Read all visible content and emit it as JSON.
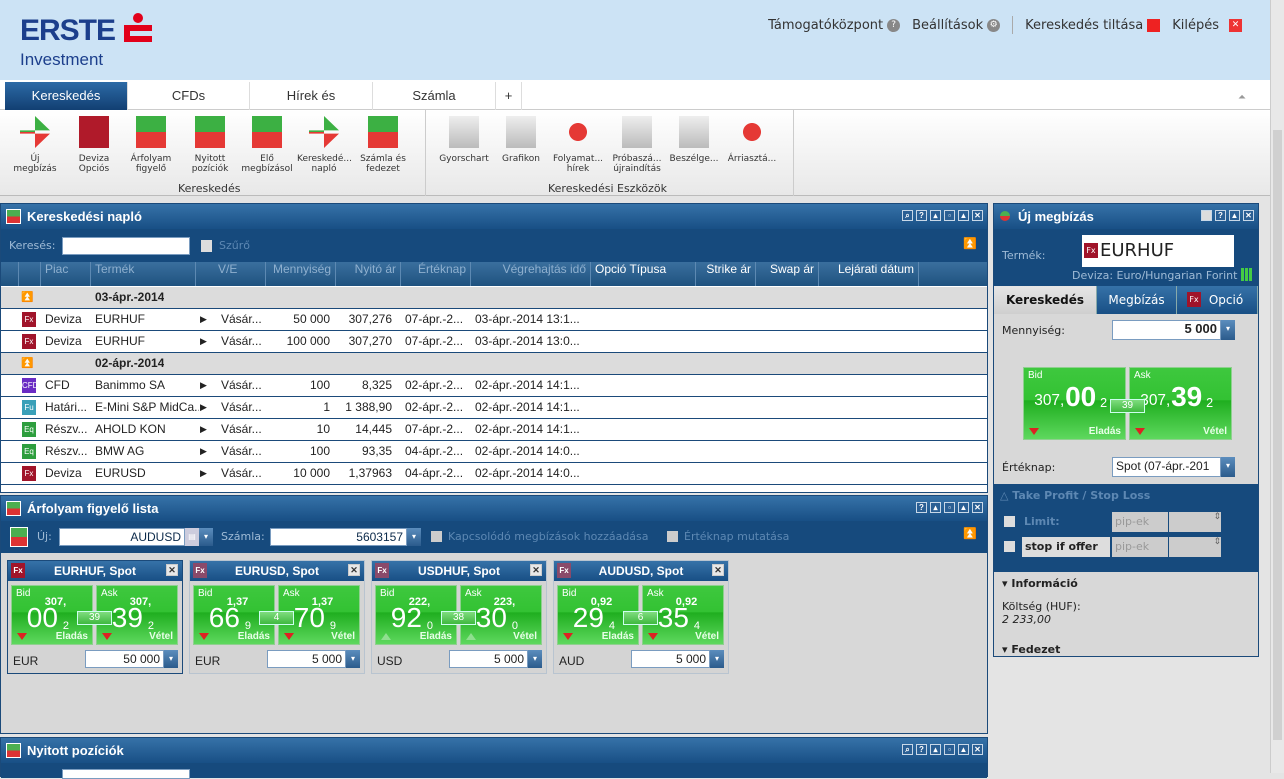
{
  "brand": {
    "line1": "ERSTE",
    "line2": "Investment",
    "color": "#1c3f8c",
    "accent": "#e2001a"
  },
  "toplinks": [
    {
      "label": "Támogatóközpont",
      "icon": "help-icon"
    },
    {
      "label": "Beállítások",
      "icon": "gear-icon"
    },
    {
      "label": "Kereskedés tiltása",
      "icon": "stop-icon"
    },
    {
      "label": "Kilépés",
      "icon": "close-icon"
    }
  ],
  "tabs": [
    "Kereskedés",
    "CFDs",
    "Hírek és",
    "Számla",
    "+"
  ],
  "ribbon": {
    "groups": [
      "Kereskedés",
      "Kereskedési Eszközök"
    ],
    "items": [
      [
        "Új",
        "megbízás"
      ],
      [
        "Deviza",
        "Opciós"
      ],
      [
        "Árfolyam",
        "figyelő"
      ],
      [
        "Nyitott",
        "pozíciók"
      ],
      [
        "Elő",
        "megbízásol"
      ],
      [
        "Kereskedé...",
        "napló"
      ],
      [
        "Számla és",
        "fedezet"
      ],
      [
        "Gyorschart",
        ""
      ],
      [
        "Grafikon",
        ""
      ],
      [
        "Folyamat...",
        "hírek"
      ],
      [
        "Próbaszá...",
        "újraindítás"
      ],
      [
        "Beszélge...",
        ""
      ],
      [
        "Árriasztá...",
        ""
      ]
    ]
  },
  "journal": {
    "title": "Kereskedési napló",
    "search_label": "Keresés:",
    "search_value": "",
    "filter_label": "Szűrő",
    "columns": [
      "Piac",
      "Termék",
      "V/E",
      "Mennyiség",
      "Nyitó ár",
      "Értéknap",
      "Végrehajtás idő",
      "Opció Típusa",
      "Strike ár",
      "Swap ár",
      "Lejárati dátum"
    ],
    "groups": [
      {
        "date": "03-ápr.-2014",
        "rows": [
          {
            "type": "Fx",
            "market": "Deviza",
            "product": "EURHUF",
            "side": "Vásár...",
            "qty": "50 000",
            "price": "307,276",
            "value": "07-ápr.-2...",
            "exec": "03-ápr.-2014 13:1..."
          },
          {
            "type": "Fx",
            "market": "Deviza",
            "product": "EURHUF",
            "side": "Vásár...",
            "qty": "100 000",
            "price": "307,270",
            "value": "07-ápr.-2...",
            "exec": "03-ápr.-2014 13:0..."
          }
        ]
      },
      {
        "date": "02-ápr.-2014",
        "rows": [
          {
            "type": "CFD",
            "market": "CFD",
            "product": "Banimmo SA",
            "side": "Vásár...",
            "qty": "100",
            "price": "8,325",
            "value": "02-ápr.-2...",
            "exec": "02-ápr.-2014 14:1..."
          },
          {
            "type": "Fu",
            "market": "Határi...",
            "product": "E-Mini S&P MidCa...",
            "side": "Vásár...",
            "qty": "1",
            "price": "1 388,90",
            "value": "02-ápr.-2...",
            "exec": "02-ápr.-2014 14:1..."
          },
          {
            "type": "Eq",
            "market": "Részv...",
            "product": "AHOLD KON",
            "side": "Vásár...",
            "qty": "10",
            "price": "14,445",
            "value": "07-ápr.-2...",
            "exec": "02-ápr.-2014 14:1..."
          },
          {
            "type": "Eq",
            "market": "Részv...",
            "product": "BMW AG",
            "side": "Vásár...",
            "qty": "100",
            "price": "93,35",
            "value": "04-ápr.-2...",
            "exec": "02-ápr.-2014 14:0..."
          },
          {
            "type": "Fx",
            "market": "Deviza",
            "product": "EURUSD",
            "side": "Vásár...",
            "qty": "10 000",
            "price": "1,37963",
            "value": "04-ápr.-2...",
            "exec": "02-ápr.-2014 14:0..."
          }
        ]
      }
    ]
  },
  "watch": {
    "title": "Árfolyam figyelő lista",
    "new_label": "Új:",
    "new_value": "AUDUSD",
    "account_label": "Számla:",
    "account_value": "5603157",
    "opt1": "Kapcsolódó megbízások hozzáadása",
    "opt2": "Értéknap mutatása",
    "cards": [
      {
        "title": "EURHUF, Spot",
        "bid_pre": "307,",
        "bid_big": "00",
        "bid_sub": "2",
        "ask_pre": "307,",
        "ask_big": "39",
        "ask_sub": "2",
        "spread": "39",
        "dir": "down",
        "ccy": "EUR",
        "qty": "50 000"
      },
      {
        "title": "EURUSD, Spot",
        "bid_pre": "1,37",
        "bid_big": "66",
        "bid_sub": "9",
        "ask_pre": "1,37",
        "ask_big": "70",
        "ask_sub": "9",
        "spread": "4",
        "dir": "down",
        "ccy": "EUR",
        "qty": "5 000"
      },
      {
        "title": "USDHUF, Spot",
        "bid_pre": "222,",
        "bid_big": "92",
        "bid_sub": "0",
        "ask_pre": "223,",
        "ask_big": "30",
        "ask_sub": "0",
        "spread": "38",
        "dir": "up",
        "ccy": "USD",
        "qty": "5 000"
      },
      {
        "title": "AUDUSD, Spot",
        "bid_pre": "0,92",
        "bid_big": "29",
        "bid_sub": "4",
        "ask_pre": "0,92",
        "ask_big": "35",
        "ask_sub": "4",
        "spread": "6",
        "dir": "down",
        "ccy": "AUD",
        "qty": "5 000"
      }
    ],
    "bid": "Bid",
    "ask": "Ask",
    "sell": "Eladás",
    "buy": "Vétel"
  },
  "positions": {
    "title": "Nyitott pozíciók"
  },
  "order": {
    "title": "Új megbízás",
    "product_label": "Termék:",
    "product": "EURHUF",
    "desc": "Deviza: Euro/Hungarian Forint",
    "tabs": [
      "Kereskedés",
      "Megbízás",
      "Opció"
    ],
    "qty_label": "Mennyiség:",
    "qty": "5 000",
    "bid_pre": "307,",
    "bid_big": "00",
    "bid_sub": "2",
    "ask_pre": "307,",
    "ask_big": "39",
    "ask_sub": "2",
    "spread": "39",
    "value_label": "Értéknap:",
    "value": "Spot (07-ápr.-201",
    "tpsl": "Take Profit / Stop Loss",
    "limit": "Limit:",
    "stop": "stop if offer",
    "pips": "pip-ek",
    "info": "Információ",
    "cost_label": "Költség (HUF):",
    "cost": "2 233,00",
    "margin": "Fedezet"
  }
}
